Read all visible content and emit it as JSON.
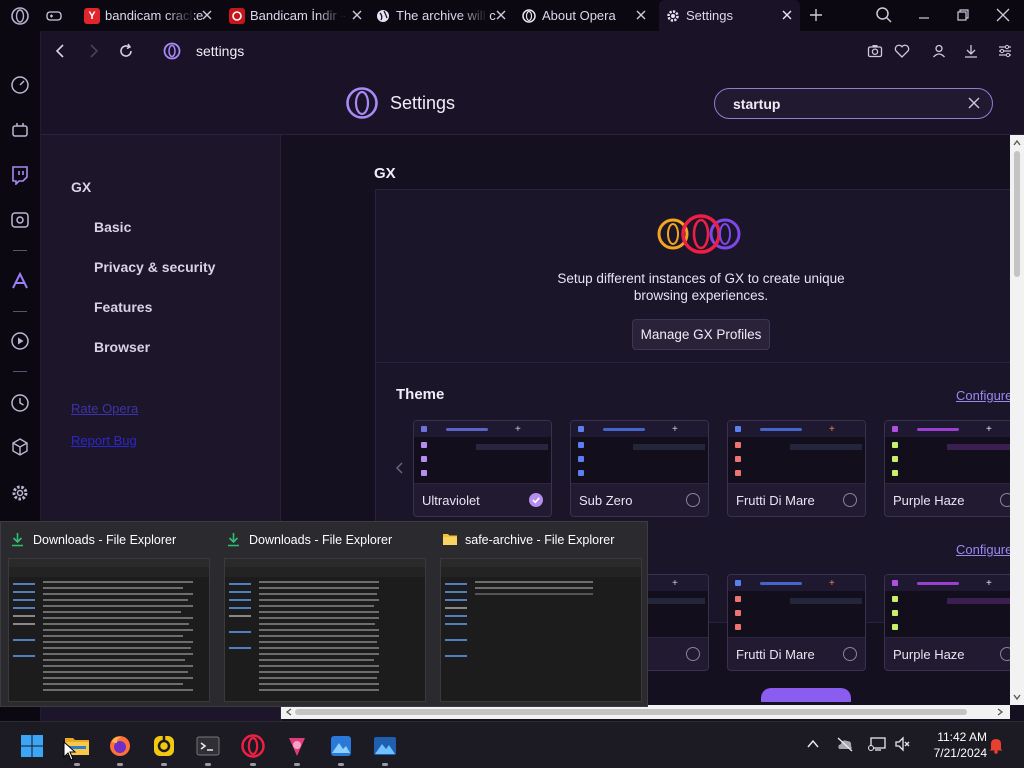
{
  "tabs": [
    {
      "title": "",
      "icon": "gamepad-icon"
    },
    {
      "title": "bandicam cracke",
      "icon": "yandex-icon"
    },
    {
      "title": "Bandicam İndir -",
      "icon": "bandicam-icon"
    },
    {
      "title": "The archive will c",
      "icon": "globe-icon"
    },
    {
      "title": "About Opera",
      "icon": "opera-icon"
    },
    {
      "title": "Settings",
      "icon": "gear-icon"
    }
  ],
  "address": {
    "url": "settings"
  },
  "settings": {
    "title": "Settings",
    "search_value": "startup"
  },
  "nav": {
    "section": "GX",
    "items": [
      "Basic",
      "Privacy & security",
      "Features",
      "Browser"
    ],
    "links": [
      "Rate Opera",
      "Report Bug"
    ]
  },
  "gx": {
    "heading": "GX",
    "description_line1": "Setup different instances of GX to create unique",
    "description_line2": "browsing experiences.",
    "manage_button": "Manage GX Profiles"
  },
  "theme": {
    "heading": "Theme",
    "configure": "Configure",
    "tiles": [
      {
        "name": "Ultraviolet",
        "checked": true,
        "accent": "#b58ef0"
      },
      {
        "name": "Sub Zero",
        "checked": false,
        "accent": "#5b7ff0"
      },
      {
        "name": "Frutti Di Mare",
        "checked": false,
        "accent": "#f07373"
      },
      {
        "name": "Purple Haze",
        "checked": false,
        "accent": "#c8f06a"
      }
    ],
    "row2_configure": "Configure",
    "row2_tiles": [
      {
        "name": "",
        "checked": false
      },
      {
        "name": "Frutti Di Mare",
        "checked": false
      },
      {
        "name": "Purple Haze",
        "checked": false
      }
    ]
  },
  "popup": {
    "windows": [
      {
        "title": "Downloads - File Explorer",
        "icon": "download-icon"
      },
      {
        "title": "Downloads - File Explorer",
        "icon": "download-icon"
      },
      {
        "title": "safe-archive - File Explorer",
        "icon": "folder-icon"
      }
    ]
  },
  "taskbar": {
    "apps": [
      "windows-start-icon",
      "file-explorer-icon",
      "firefox-icon",
      "app-icon",
      "terminal-icon",
      "opera-gx-icon",
      "app-icon-2",
      "photos-icon",
      "photos-icon-2"
    ],
    "time": "11:42 AM",
    "date": "7/21/2024"
  }
}
